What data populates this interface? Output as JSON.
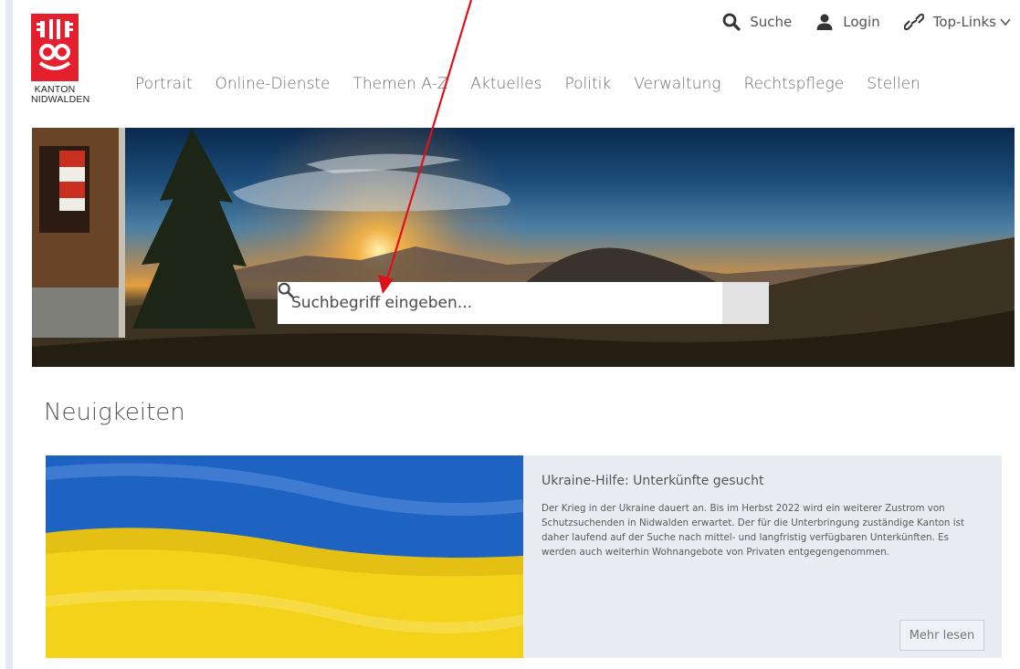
{
  "header": {
    "logo_line1": "KANTON",
    "logo_line2": "NIDWALDEN",
    "utility": {
      "search_label": "Suche",
      "login_label": "Login",
      "toplinks_label": "Top-Links"
    },
    "nav": [
      {
        "label": "Portrait"
      },
      {
        "label": "Online-Dienste"
      },
      {
        "label": "Themen A-Z"
      },
      {
        "label": "Aktuelles"
      },
      {
        "label": "Politik"
      },
      {
        "label": "Verwaltung"
      },
      {
        "label": "Rechtspflege"
      },
      {
        "label": "Stellen"
      }
    ]
  },
  "hero": {
    "search_placeholder": "Suchbegriff eingeben..."
  },
  "news": {
    "section_title": "Neuigkeiten",
    "items": [
      {
        "title": "Ukraine-Hilfe: Unterkünfte gesucht",
        "text": "Der Krieg in der Ukraine dauert an. Bis im Herbst 2022 wird ein weiterer Zustrom von Schutzsuchenden in Nidwalden erwartet. Der für die Unterbringung zuständige Kanton ist daher laufend auf der Suche nach mittel- und langfristig verfügbaren Unterkünften. Es werden auch weiterhin Wohnangebote von Privaten entgegengenommen.",
        "more_label": "Mehr lesen"
      }
    ]
  },
  "colors": {
    "brand_red": "#e5202e",
    "annotation_arrow": "#e0101b",
    "flag_blue": "#1f63c2",
    "flag_yellow": "#f4d21a"
  }
}
